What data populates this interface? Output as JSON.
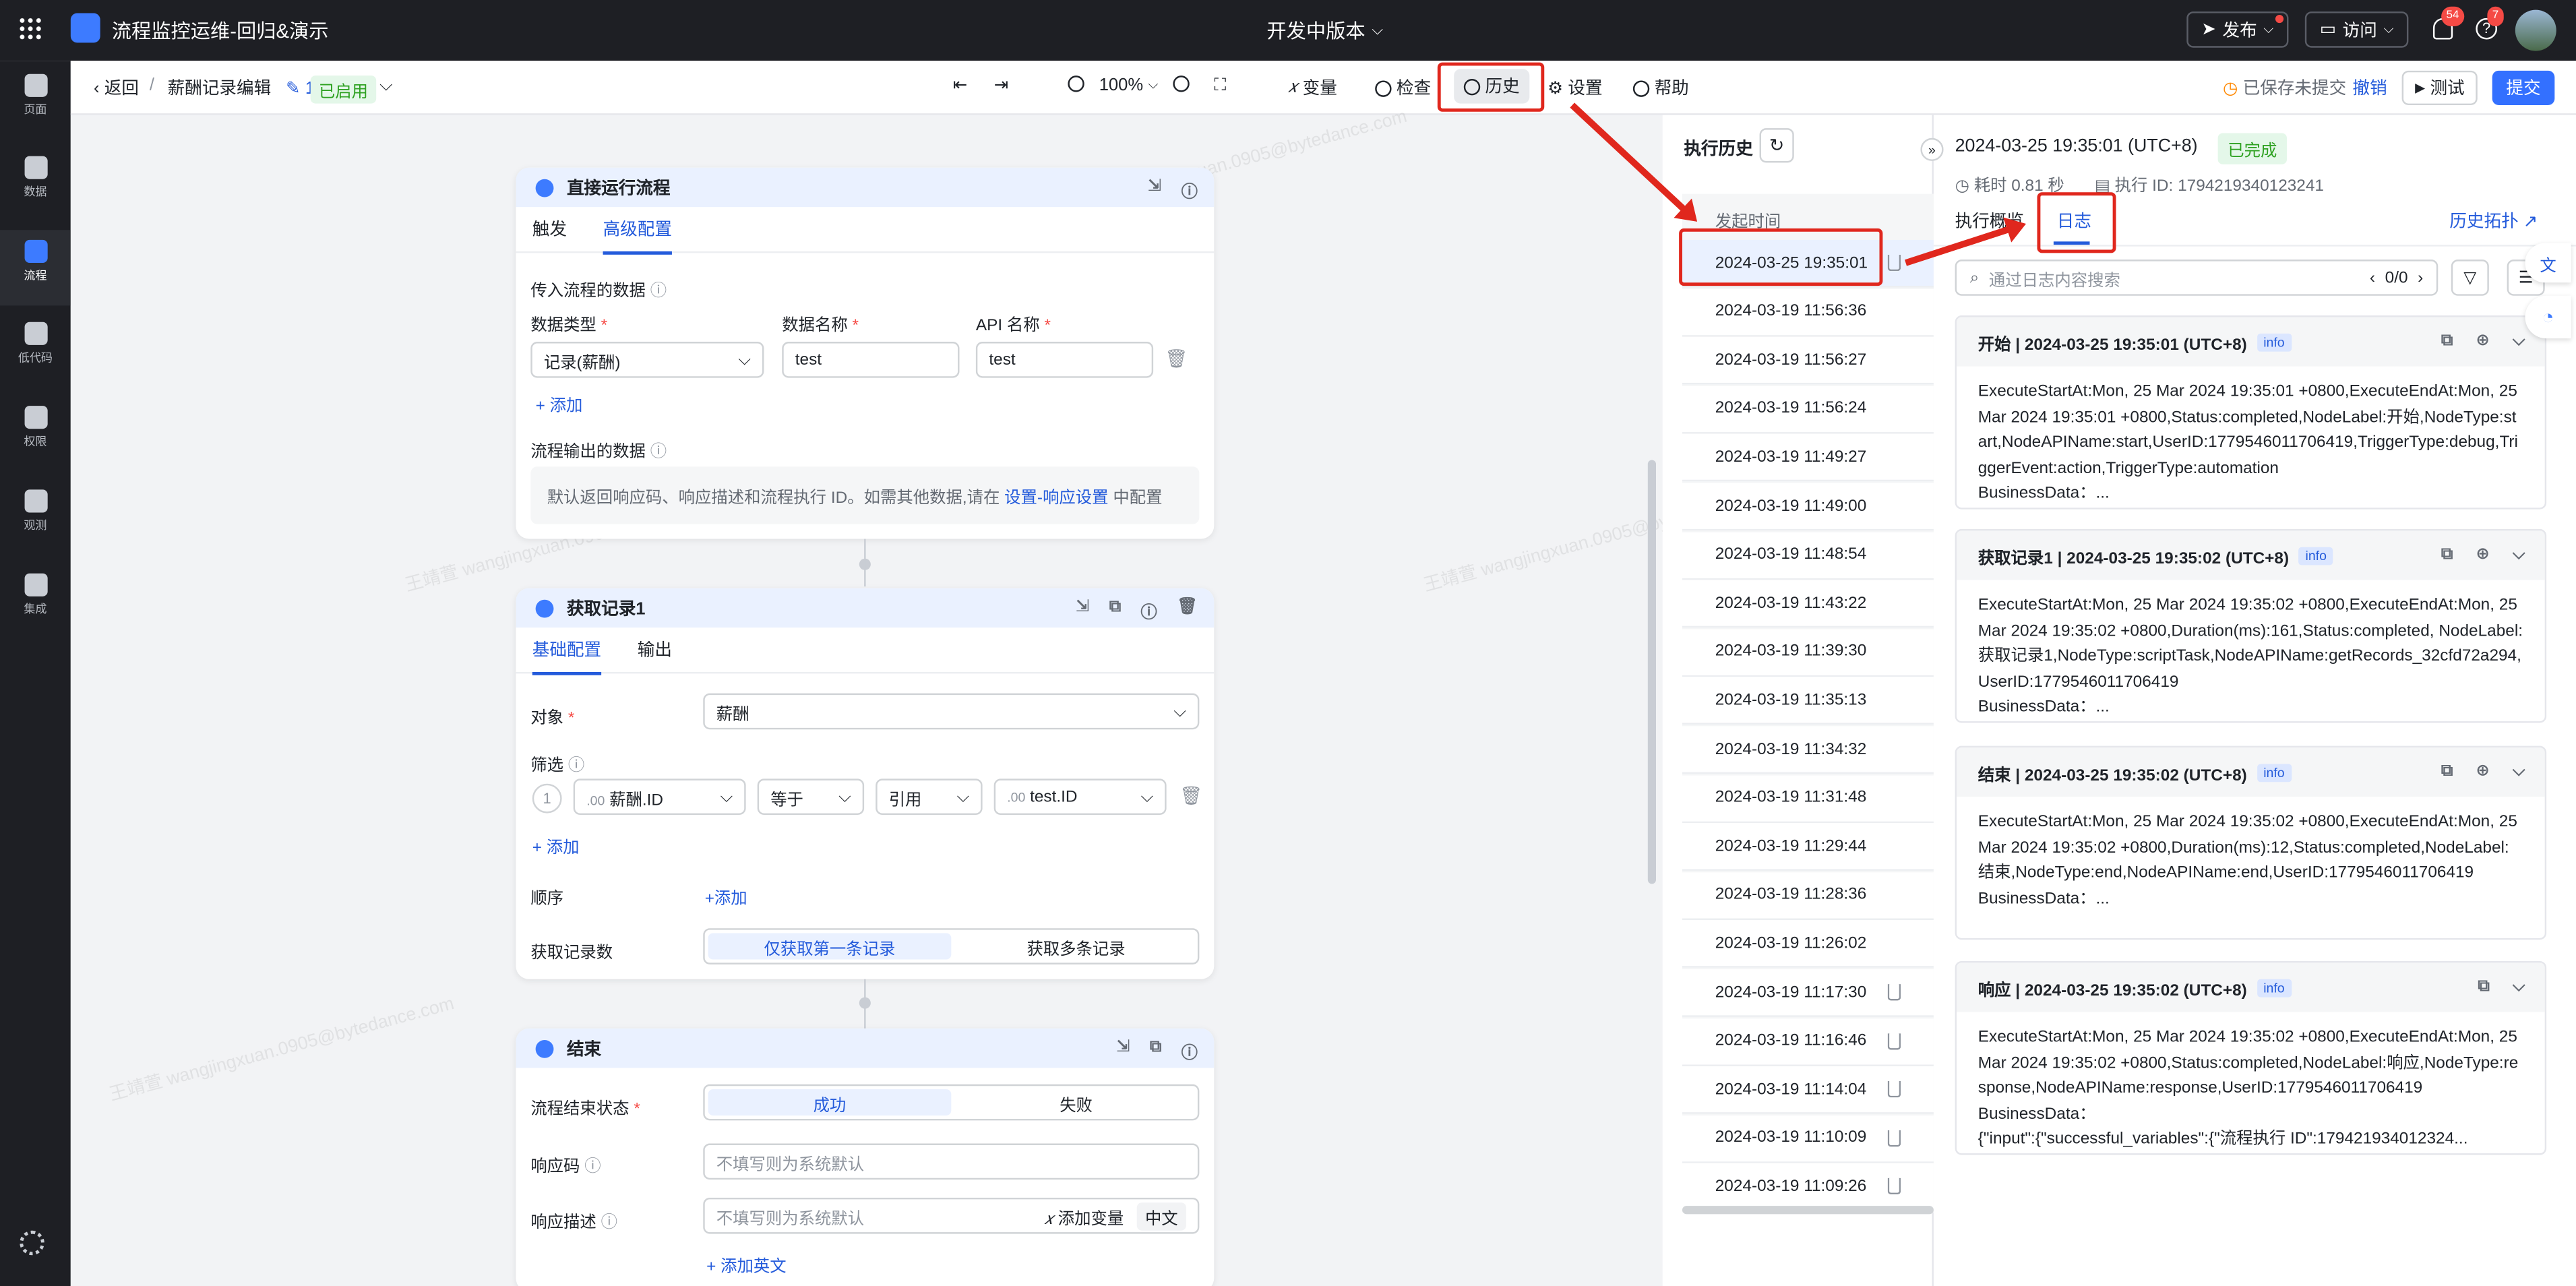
{
  "topbar": {
    "app_title": "流程监控运维-回归&演示",
    "version": "开发中版本",
    "publish": "发布",
    "visit": "访问",
    "notif_count": "54",
    "help_count": "7"
  },
  "leftnav": [
    {
      "label": "页面"
    },
    {
      "label": "数据"
    },
    {
      "label": "流程"
    },
    {
      "label": "低代码"
    },
    {
      "label": "权限"
    },
    {
      "label": "观测"
    },
    {
      "label": "集成"
    }
  ],
  "toolbar": {
    "back": "返回",
    "breadcrumb": "薪酬记录编辑",
    "version": "1",
    "status": "已启用",
    "zoom": "100%",
    "variables": "变量",
    "check": "检查",
    "history": "历史",
    "settings": "设置",
    "help": "帮助",
    "saved": "已保存未提交",
    "undo": "撤销",
    "test": "测试",
    "submit": "提交"
  },
  "node1": {
    "title": "直接运行流程",
    "tab1": "触发",
    "tab2": "高级配置",
    "input_section": "传入流程的数据",
    "col_type": "数据类型",
    "col_name": "数据名称",
    "col_api": "API 名称",
    "type_value": "记录(薪酬)",
    "name_value": "test",
    "api_value": "test",
    "add": "添加",
    "output_section": "流程输出的数据",
    "output_note": "默认返回响应码、响应描述和流程执行 ID。如需其他数据,请在",
    "output_link": "设置-响应设置",
    "output_tail": "中配置"
  },
  "node2": {
    "title": "获取记录1",
    "tab1": "基础配置",
    "tab2": "输出",
    "object_label": "对象",
    "object_value": "薪酬",
    "filter_label": "筛选",
    "filter_index": "1",
    "filter_field": "薪酬.ID",
    "filter_op": "等于",
    "filter_mode": "引用",
    "filter_value": "test.ID",
    "add_filter": "添加",
    "order_label": "顺序",
    "order_add": "添加",
    "count_label": "获取记录数",
    "count_opt1": "仅获取第一条记录",
    "count_opt2": "获取多条记录"
  },
  "node3": {
    "title": "结束",
    "status_label": "流程结束状态",
    "status_ok": "成功",
    "status_fail": "失败",
    "code_label": "响应码",
    "code_placeholder": "不填写则为系统默认",
    "desc_label": "响应描述",
    "desc_placeholder": "不填写则为系统默认",
    "add_var": "添加变量",
    "lang": "中文",
    "add_en": "添加英文"
  },
  "history": {
    "title": "执行历史",
    "col": "发起时间",
    "rows": [
      "2024-03-25 19:35:01",
      "2024-03-19 11:56:36",
      "2024-03-19 11:56:27",
      "2024-03-19 11:56:24",
      "2024-03-19 11:49:27",
      "2024-03-19 11:49:00",
      "2024-03-19 11:48:54",
      "2024-03-19 11:43:22",
      "2024-03-19 11:39:30",
      "2024-03-19 11:35:13",
      "2024-03-19 11:34:32",
      "2024-03-19 11:31:48",
      "2024-03-19 11:29:44",
      "2024-03-19 11:28:36",
      "2024-03-19 11:26:02",
      "2024-03-19 11:17:30",
      "2024-03-19 11:16:46",
      "2024-03-19 11:14:04",
      "2024-03-19 11:10:09",
      "2024-03-19 11:09:26"
    ]
  },
  "detail": {
    "time": "2024-03-25 19:35:01 (UTC+8)",
    "status": "已完成",
    "duration": "耗时 0.81 秒",
    "exec_id": "执行 ID: 1794219340123241",
    "tab_overview": "执行概览",
    "tab_log": "日志",
    "history_link": "历史拓扑",
    "search_placeholder": "通过日志内容搜索",
    "pager": "0/0",
    "logs": [
      {
        "title": "开始 | 2024-03-25 19:35:01 (UTC+8)",
        "level": "info",
        "body": "ExecuteStartAt:Mon, 25 Mar 2024 19:35:01 +0800,ExecuteEndAt:Mon, 25 Mar 2024 19:35:01 +0800,Status:completed,NodeLabel:开始,NodeType:start,NodeAPIName:start,UserID:1779546011706419,TriggerType:debug,TriggerEvent:action,TriggerType:automation",
        "tail": "BusinessData：..."
      },
      {
        "title": "获取记录1 | 2024-03-25 19:35:02 (UTC+8)",
        "level": "info",
        "body": "ExecuteStartAt:Mon, 25 Mar 2024 19:35:02 +0800,ExecuteEndAt:Mon, 25 Mar 2024 19:35:02 +0800,Duration(ms):161,Status:completed, NodeLabel:获取记录1,NodeType:scriptTask,NodeAPIName:getRecords_32cfd72a294,UserID:1779546011706419",
        "tail": "BusinessData：..."
      },
      {
        "title": "结束 | 2024-03-25 19:35:02 (UTC+8)",
        "level": "info",
        "body": "ExecuteStartAt:Mon, 25 Mar 2024 19:35:02 +0800,ExecuteEndAt:Mon, 25 Mar 2024 19:35:02 +0800,Duration(ms):12,Status:completed,NodeLabel:结束,NodeType:end,NodeAPIName:end,UserID:1779546011706419",
        "tail": "BusinessData：..."
      },
      {
        "title": "响应 | 2024-03-25 19:35:02 (UTC+8)",
        "level": "info",
        "body": "ExecuteStartAt:Mon, 25 Mar 2024 19:35:02 +0800,ExecuteEndAt:Mon, 25 Mar 2024 19:35:02 +0800,Status:completed,NodeLabel:响应,NodeType:response,NodeAPIName:response,UserID:1779546011706419",
        "tail": "BusinessData：",
        "tail2": "{\"input\":{\"successful_variables\":{\"流程执行 ID\":179421934012324..."
      }
    ]
  }
}
